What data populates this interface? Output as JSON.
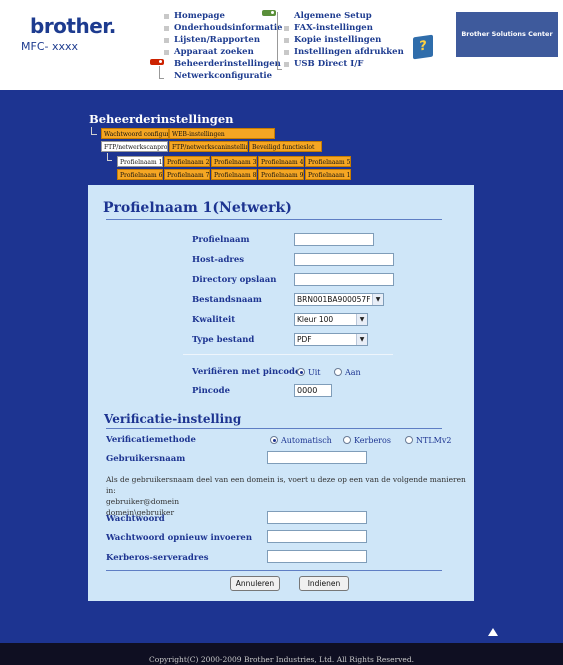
{
  "header": {
    "logo": "brother.",
    "model": "MFC- xxxx",
    "nav_left": [
      "Homepage",
      "Onderhoudsinformatie",
      "Lijsten/Rapporten",
      "Apparaat zoeken",
      "Beheerderinstellingen",
      "Netwerkconfiguratie"
    ],
    "nav_right": [
      "Algemene Setup",
      "FAX-instellingen",
      "Kopie instellingen",
      "Instellingen afdrukken",
      "USB Direct I/F"
    ],
    "help_icon": "?",
    "solutions_label": "Brother Solutions Center"
  },
  "main": {
    "section_title": "Beheerderinstellingen",
    "tabs_row1": [
      "Wachtwoord configureren",
      "WEB-instellingen"
    ],
    "tabs_row2": [
      "FTP/netwerkscanprofiel",
      "FTP/netwerkscaninstellingen",
      "Beveiligd functieslot"
    ],
    "profile_tabs_row1": [
      "Profielnaam 1",
      "Profielnaam 2",
      "Profielnaam 3",
      "Profielnaam 4",
      "Profielnaam 5"
    ],
    "profile_tabs_row2": [
      "Profielnaam 6",
      "Profielnaam 7",
      "Profielnaam 8",
      "Profielnaam 9",
      "Profielnaam 10"
    ]
  },
  "form": {
    "title": "Profielnaam 1(Netwerk)",
    "profielnaam_label": "Profielnaam",
    "profielnaam_value": "",
    "host_label": "Host-adres",
    "host_value": "",
    "directory_label": "Directory opslaan",
    "directory_value": "",
    "bestandsnaam_label": "Bestandsnaam",
    "bestandsnaam_value": "BRN001BA900057F",
    "kwaliteit_label": "Kwaliteit",
    "kwaliteit_value": "Kleur 100",
    "type_label": "Type bestand",
    "type_value": "PDF",
    "verify_pin_label": "Verifiëren met pincode",
    "verify_pin_options": [
      "Uit",
      "Aan"
    ],
    "pincode_label": "Pincode",
    "pincode_value": "0000"
  },
  "auth": {
    "title": "Verificatie-instelling",
    "method_label": "Verificatiemethode",
    "method_options": [
      "Automatisch",
      "Kerberos",
      "NTLMv2"
    ],
    "user_label": "Gebruikersnaam",
    "user_value": "",
    "help_line1": "Als de gebruikersnaam deel van een domein is, voert u deze op een van de volgende manieren in:",
    "help_line2": "gebruiker@domein",
    "help_line3": "domein\\gebruiker",
    "password_label": "Wachtwoord",
    "password_value": "",
    "password_repeat_label": "Wachtwoord opnieuw invoeren",
    "password_repeat_value": "",
    "kerberos_label": "Kerberos-serveradres",
    "kerberos_value": ""
  },
  "buttons": {
    "cancel": "Annuleren",
    "submit": "Indienen"
  },
  "footer": {
    "copyright": "Copyright(C) 2000-2009 Brother Industries, Ltd. All Rights Reserved."
  },
  "colors": {
    "brand_blue": "#1d3491",
    "panel_bg": "#cfe6f8",
    "tab_orange": "#f5a623"
  }
}
